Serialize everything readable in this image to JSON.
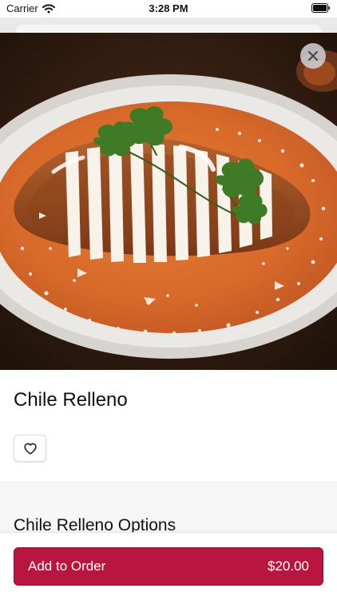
{
  "status_bar": {
    "carrier": "Carrier",
    "time": "3:28 PM"
  },
  "item": {
    "title": "Chile Relleno",
    "image_icon": "food-photo"
  },
  "options": {
    "title": "Chile Relleno Options"
  },
  "order": {
    "button_label": "Add to Order",
    "price": "$20.00"
  },
  "colors": {
    "accent": "#b81541",
    "accent_border": "#8e0f2c",
    "section_bg": "#f7f7f7"
  },
  "icons": {
    "close": "close-icon",
    "favorite": "heart-icon",
    "wifi": "wifi-icon",
    "battery": "battery-icon"
  }
}
